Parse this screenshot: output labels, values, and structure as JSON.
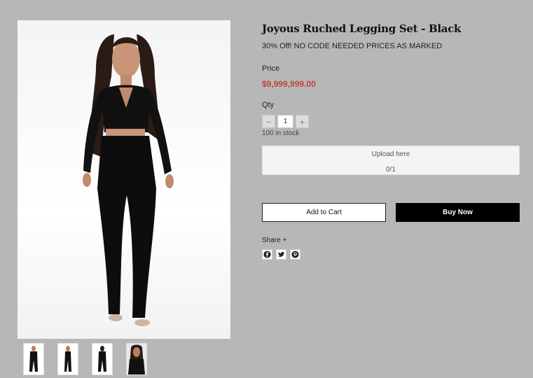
{
  "product": {
    "title": "Joyous Ruched Legging Set - Black",
    "promo": "30% Off! NO CODE NEEDED PRICES AS MARKED",
    "price_label": "Price",
    "price": "$9,999,999.00",
    "qty_label": "Qty",
    "qty_minus": "−",
    "qty_value": "1",
    "qty_plus": "+",
    "stock": "100 in stock"
  },
  "upload": {
    "title": "Upload here",
    "count": "0/1"
  },
  "actions": {
    "add_to_cart": "Add to Cart",
    "buy_now": "Buy Now"
  },
  "share": {
    "label": "Share +",
    "icons": [
      "facebook-icon",
      "twitter-icon",
      "pinterest-icon"
    ]
  },
  "gallery": {
    "main_image": "model-in-black-ruched-set",
    "thumbnails": [
      "front-full",
      "side-full",
      "back-full",
      "front-closeup"
    ]
  },
  "colors": {
    "page_bg": "#b7b7b7",
    "price": "#c0443f",
    "buy_button": "#000000"
  }
}
